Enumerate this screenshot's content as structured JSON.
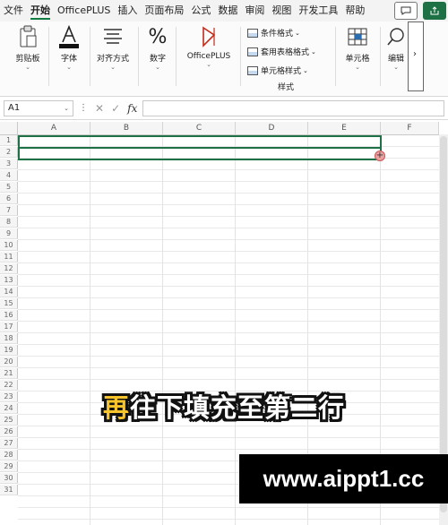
{
  "menu": {
    "items": [
      "文件",
      "开始",
      "OfficePLUS",
      "插入",
      "页面布局",
      "公式",
      "数据",
      "审阅",
      "视图",
      "开发工具",
      "帮助"
    ],
    "active": "开始"
  },
  "ribbon": {
    "clipboard": "剪贴板",
    "font": "字体",
    "align": "对齐方式",
    "number": "数字",
    "number_icon": "%",
    "officeplus": "OfficePLUS",
    "conditional": "条件格式",
    "table_format": "套用表格格式",
    "cell_style": "单元格样式",
    "styles_group": "样式",
    "cells": "单元格",
    "edit": "编辑",
    "more": "›"
  },
  "formula_bar": {
    "name_box": "A1",
    "fx": "fx",
    "value": ""
  },
  "grid": {
    "columns": [
      "A",
      "B",
      "C",
      "D",
      "E",
      "F"
    ],
    "rows": [
      "1",
      "2",
      "3",
      "4",
      "5",
      "6",
      "7",
      "8",
      "9",
      "10",
      "11",
      "12",
      "13",
      "14",
      "15",
      "16",
      "17",
      "18",
      "19",
      "20",
      "21",
      "22",
      "23",
      "24",
      "25",
      "26",
      "27",
      "28",
      "29",
      "30",
      "31"
    ]
  },
  "caption": {
    "part1": "再",
    "part2": "往下填充至第二行"
  },
  "watermark": "www.aippt1.cc",
  "colors": {
    "accent": "#107c41",
    "selection": "#1e7145",
    "caption_highlight": "#f7c52b"
  }
}
